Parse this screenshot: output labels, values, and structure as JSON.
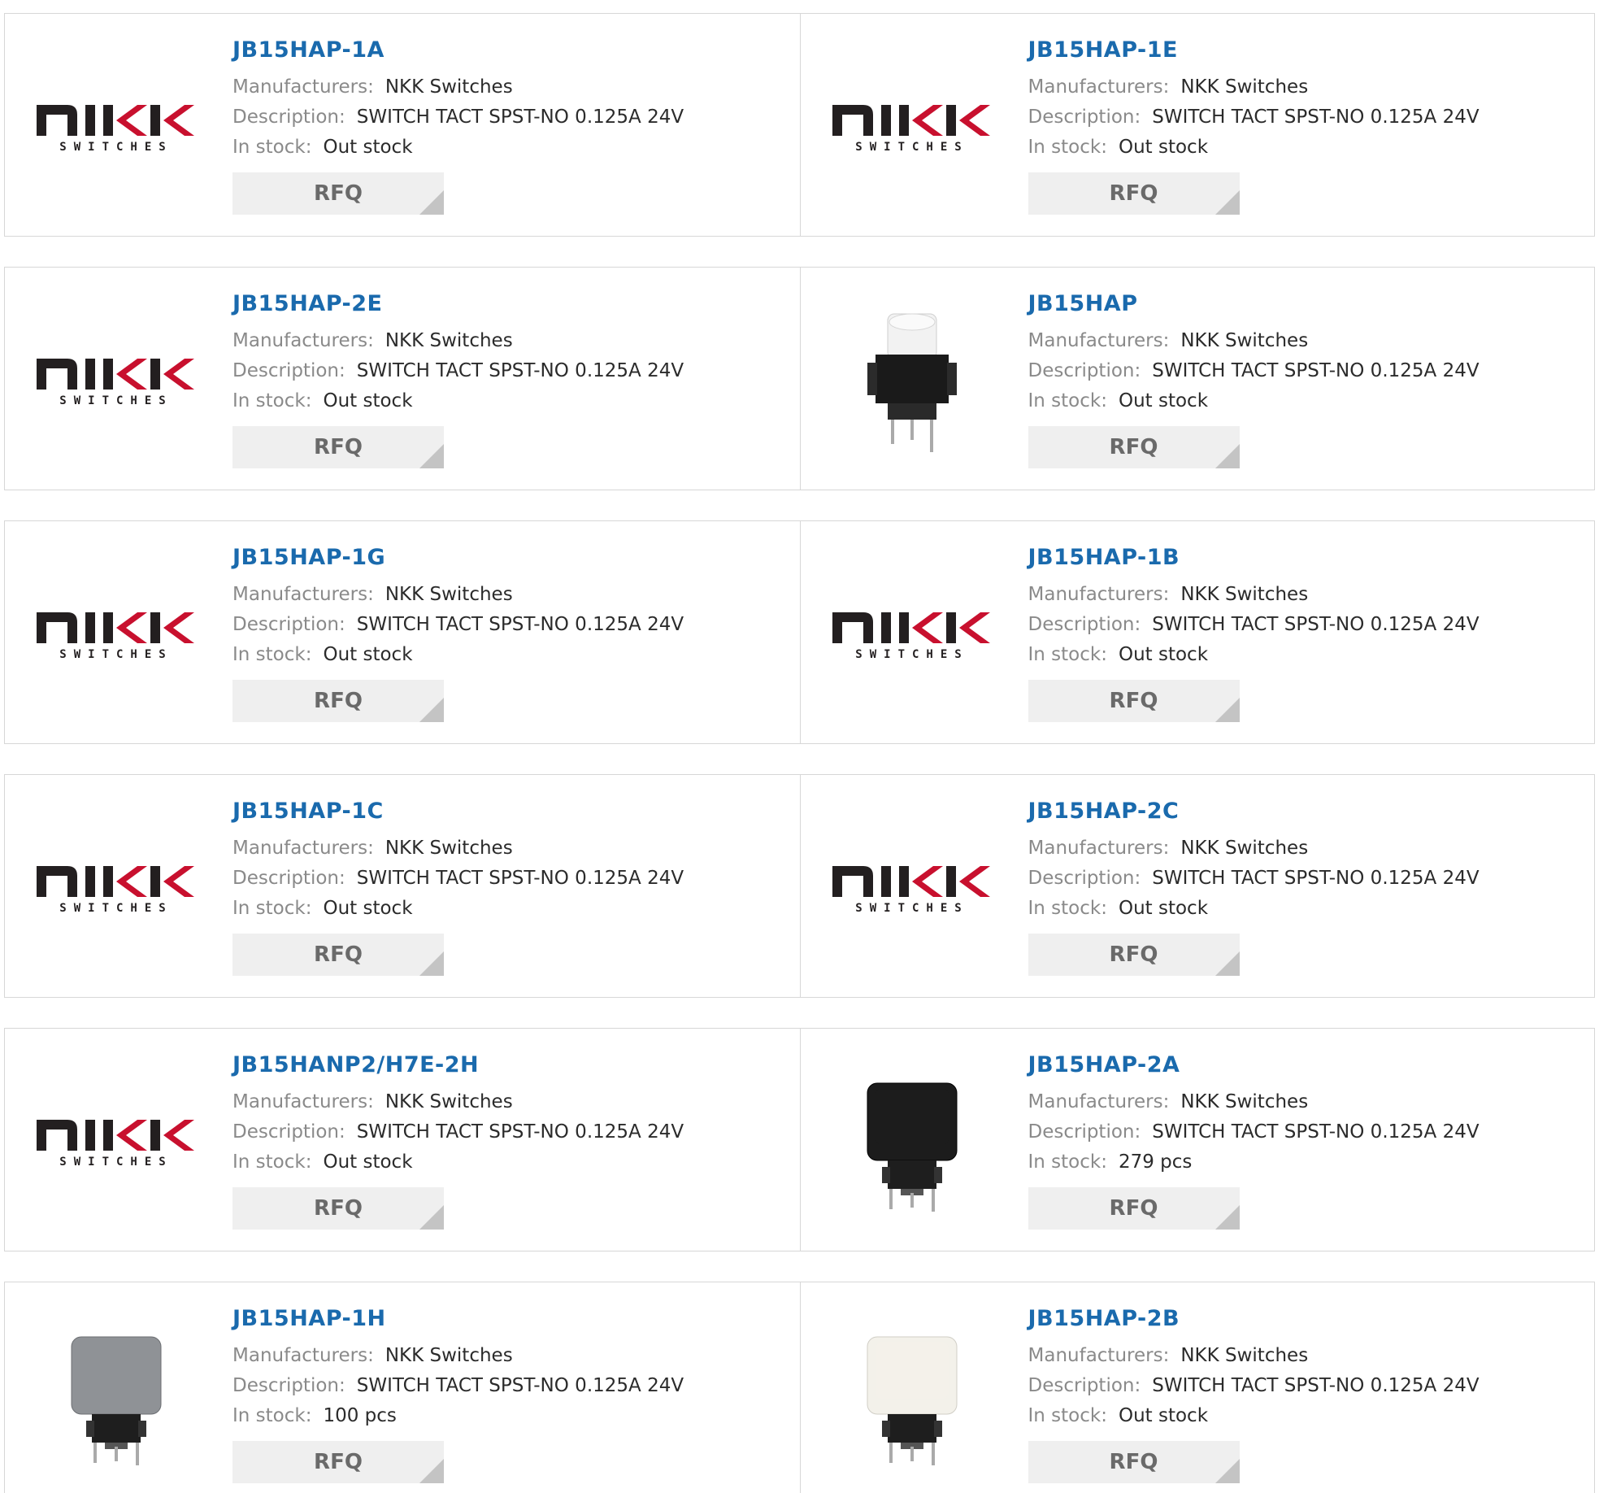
{
  "labels": {
    "manufacturers": "Manufacturers:",
    "description": "Description:",
    "in_stock": "In stock:",
    "rfq": "RFQ"
  },
  "logo": {
    "brand_text": "NKK",
    "sub_text": "SWITCHES",
    "color": "#231f20",
    "accent": "#c8102e"
  },
  "colors": {
    "link": "#1a6aad",
    "label": "#8a8a8a",
    "value": "#2b2b2b",
    "border": "#d7d7d7",
    "button_bg": "#efefef"
  },
  "products": [
    {
      "part": "JB15HAP-1A",
      "manufacturer": "NKK Switches",
      "description": "SWITCH TACT SPST-NO 0.125A 24V",
      "stock": "Out stock",
      "image": "nkk-logo"
    },
    {
      "part": "JB15HAP-1E",
      "manufacturer": "NKK Switches",
      "description": "SWITCH TACT SPST-NO 0.125A 24V",
      "stock": "Out stock",
      "image": "nkk-logo"
    },
    {
      "part": "JB15HAP-2E",
      "manufacturer": "NKK Switches",
      "description": "SWITCH TACT SPST-NO 0.125A 24V",
      "stock": "Out stock",
      "image": "nkk-logo"
    },
    {
      "part": "JB15HAP",
      "manufacturer": "NKK Switches",
      "description": "SWITCH TACT SPST-NO 0.125A 24V",
      "stock": "Out stock",
      "image": "switch-white-round-stem"
    },
    {
      "part": "JB15HAP-1G",
      "manufacturer": "NKK Switches",
      "description": "SWITCH TACT SPST-NO 0.125A 24V",
      "stock": "Out stock",
      "image": "nkk-logo"
    },
    {
      "part": "JB15HAP-1B",
      "manufacturer": "NKK Switches",
      "description": "SWITCH TACT SPST-NO 0.125A 24V",
      "stock": "Out stock",
      "image": "nkk-logo"
    },
    {
      "part": "JB15HAP-1C",
      "manufacturer": "NKK Switches",
      "description": "SWITCH TACT SPST-NO 0.125A 24V",
      "stock": "Out stock",
      "image": "nkk-logo"
    },
    {
      "part": "JB15HAP-2C",
      "manufacturer": "NKK Switches",
      "description": "SWITCH TACT SPST-NO 0.125A 24V",
      "stock": "Out stock",
      "image": "nkk-logo"
    },
    {
      "part": "JB15HANP2/H7E-2H",
      "manufacturer": "NKK Switches",
      "description": "SWITCH TACT SPST-NO 0.125A 24V",
      "stock": "Out stock",
      "image": "nkk-logo"
    },
    {
      "part": "JB15HAP-2A",
      "manufacturer": "NKK Switches",
      "description": "SWITCH TACT SPST-NO 0.125A 24V",
      "stock": "279 pcs",
      "image": "switch-black-cap"
    },
    {
      "part": "JB15HAP-1H",
      "manufacturer": "NKK Switches",
      "description": "SWITCH TACT SPST-NO 0.125A 24V",
      "stock": "100 pcs",
      "image": "switch-gray-cap"
    },
    {
      "part": "JB15HAP-2B",
      "manufacturer": "NKK Switches",
      "description": "SWITCH TACT SPST-NO 0.125A 24V",
      "stock": "Out stock",
      "image": "switch-white-cap"
    }
  ]
}
